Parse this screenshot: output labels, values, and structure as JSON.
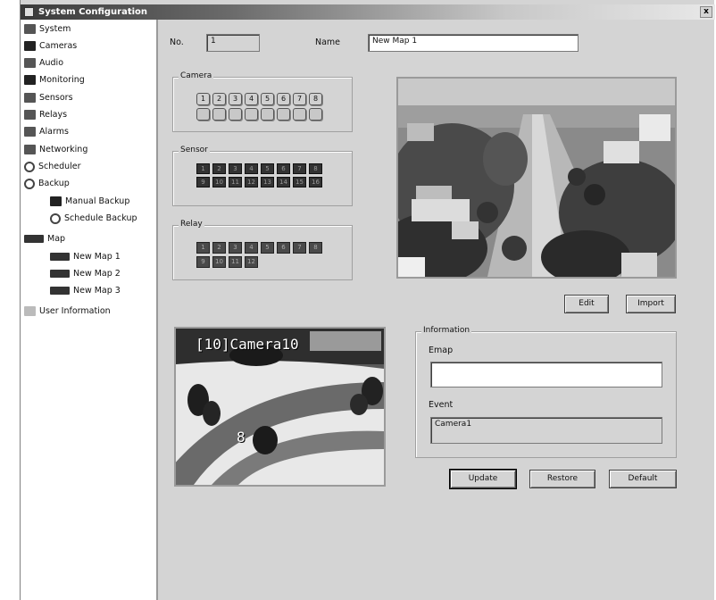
{
  "window": {
    "title": "System Configuration",
    "close_glyph": "x"
  },
  "sidebar": {
    "items": [
      {
        "label": "System",
        "icon": "system-icon"
      },
      {
        "label": "Cameras",
        "icon": "camera-icon"
      },
      {
        "label": "Audio",
        "icon": "audio-icon"
      },
      {
        "label": "Monitoring",
        "icon": "monitoring-icon"
      },
      {
        "label": "Sensors",
        "icon": "sensor-icon"
      },
      {
        "label": "Relays",
        "icon": "relay-icon"
      },
      {
        "label": "Alarms",
        "icon": "alarm-icon"
      },
      {
        "label": "Networking",
        "icon": "network-icon"
      },
      {
        "label": "Scheduler",
        "icon": "clock-icon"
      },
      {
        "label": "Backup",
        "icon": "backup-icon"
      },
      {
        "label": "Manual Backup",
        "icon": "floppy-icon"
      },
      {
        "label": "Schedule Backup",
        "icon": "schedule-backup-icon"
      },
      {
        "label": "Map",
        "icon": "map-icon"
      },
      {
        "label": "New Map 1",
        "icon": "map-thumbnail-icon"
      },
      {
        "label": "New Map 2",
        "icon": "map-thumbnail-icon"
      },
      {
        "label": "New Map 3",
        "icon": "map-thumbnail-icon"
      },
      {
        "label": "User Information",
        "icon": "user-icon"
      }
    ]
  },
  "form": {
    "no_label": "No.",
    "no_value": "1",
    "name_label": "Name",
    "name_value": "New Map 1"
  },
  "camera_group": {
    "title": "Camera",
    "buttons": [
      "1",
      "2",
      "3",
      "4",
      "5",
      "6",
      "7",
      "8",
      "",
      "",
      "",
      "",
      "",
      "",
      "",
      ""
    ]
  },
  "sensor_group": {
    "title": "Sensor",
    "buttons": [
      "1",
      "2",
      "3",
      "4",
      "5",
      "6",
      "7",
      "8",
      "9",
      "10",
      "11",
      "12",
      "13",
      "14",
      "15",
      "16"
    ]
  },
  "relay_group": {
    "title": "Relay",
    "buttons": [
      "1",
      "2",
      "3",
      "4",
      "5",
      "6",
      "7",
      "8",
      "9",
      "10",
      "11",
      "12"
    ]
  },
  "map_actions": {
    "edit": "Edit",
    "import": "Import"
  },
  "camera_view": {
    "overlay_title": "[10]Camera10",
    "overlay_number": "8"
  },
  "information": {
    "title": "Information",
    "emap_label": "Emap",
    "emap_value": "",
    "event_label": "Event",
    "event_value": "Camera1"
  },
  "actions": {
    "update": "Update",
    "restore": "Restore",
    "default": "Default"
  },
  "colors": {
    "title_dark": "#3a3a3a",
    "panel_bg": "#d4d4d4",
    "sidebar_bg": "#ffffff"
  }
}
